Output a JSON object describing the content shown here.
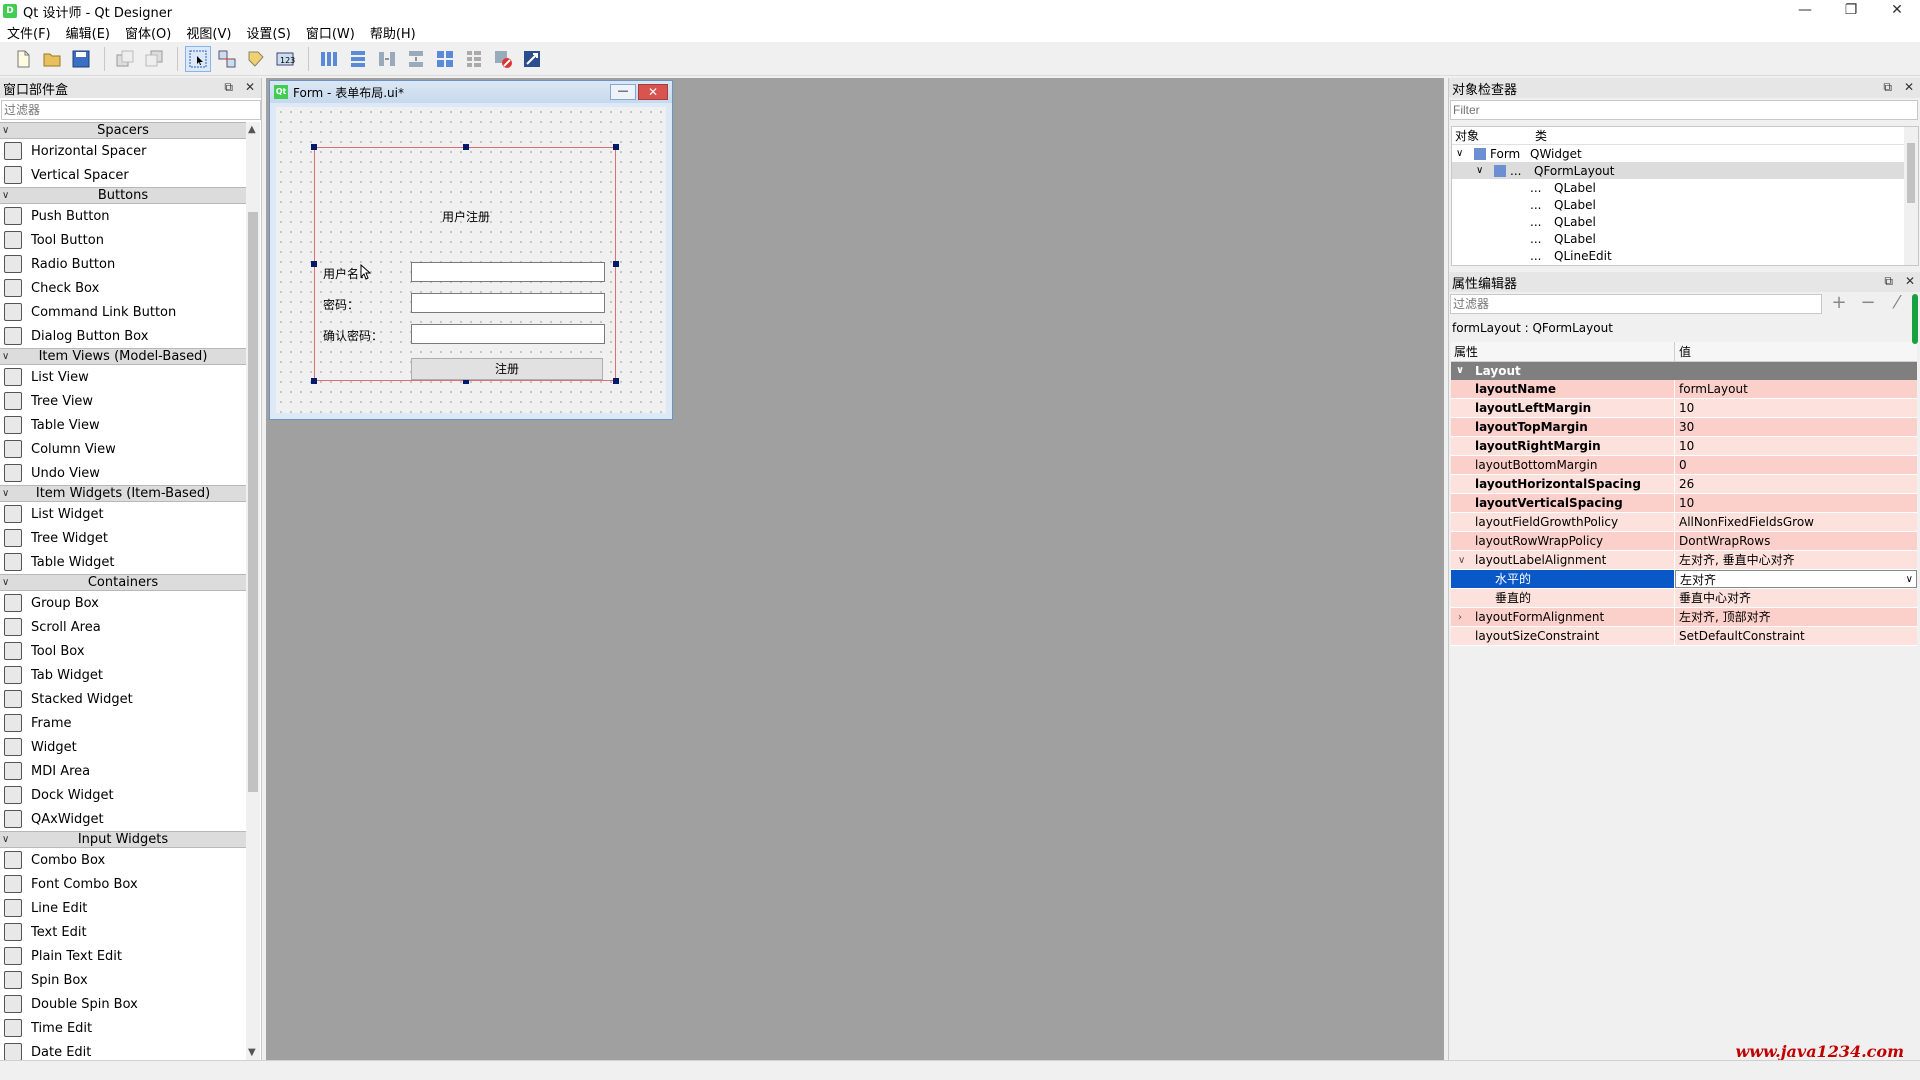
{
  "window": {
    "title": "Qt 设计师 - Qt Designer",
    "icon_text": "D",
    "minimize": "—",
    "restore": "❐",
    "close": "✕"
  },
  "menu": [
    "文件(F)",
    "编辑(E)",
    "窗体(O)",
    "视图(V)",
    "设置(S)",
    "窗口(W)",
    "帮助(H)"
  ],
  "widget_box": {
    "title": "窗口部件盒",
    "filter_placeholder": "过滤器",
    "categories": [
      {
        "name": "Spacers",
        "items": [
          "Horizontal Spacer",
          "Vertical Spacer"
        ]
      },
      {
        "name": "Buttons",
        "items": [
          "Push Button",
          "Tool Button",
          "Radio Button",
          "Check Box",
          "Command Link Button",
          "Dialog Button Box"
        ]
      },
      {
        "name": "Item Views (Model-Based)",
        "items": [
          "List View",
          "Tree View",
          "Table View",
          "Column View",
          "Undo View"
        ]
      },
      {
        "name": "Item Widgets (Item-Based)",
        "items": [
          "List Widget",
          "Tree Widget",
          "Table Widget"
        ]
      },
      {
        "name": "Containers",
        "items": [
          "Group Box",
          "Scroll Area",
          "Tool Box",
          "Tab Widget",
          "Stacked Widget",
          "Frame",
          "Widget",
          "MDI Area",
          "Dock Widget",
          "QAxWidget"
        ]
      },
      {
        "name": "Input Widgets",
        "items": [
          "Combo Box",
          "Font Combo Box",
          "Line Edit",
          "Text Edit",
          "Plain Text Edit",
          "Spin Box",
          "Double Spin Box",
          "Time Edit",
          "Date Edit"
        ]
      }
    ]
  },
  "form": {
    "window_title": "Form - 表单布局.ui*",
    "icon_text": "Qt",
    "min_glyph": "—",
    "close_glyph": "✕",
    "heading": "用户注册",
    "fields": [
      {
        "label": "用户名：",
        "value": ""
      },
      {
        "label": "密码：",
        "value": ""
      },
      {
        "label": "确认密码：",
        "value": ""
      }
    ],
    "button": "注册"
  },
  "object_inspector": {
    "title": "对象检查器",
    "filter_placeholder": "Filter",
    "columns": [
      "对象",
      "类"
    ],
    "rows": [
      {
        "object": "Form",
        "class": "QWidget",
        "indent": 0,
        "expanded": true
      },
      {
        "object": "...",
        "class": "QFormLayout",
        "indent": 1,
        "expanded": true,
        "selected": true
      },
      {
        "object": "...",
        "class": "QLabel",
        "indent": 2
      },
      {
        "object": "...",
        "class": "QLabel",
        "indent": 2
      },
      {
        "object": "...",
        "class": "QLabel",
        "indent": 2
      },
      {
        "object": "...",
        "class": "QLabel",
        "indent": 2
      },
      {
        "object": "...",
        "class": "QLineEdit",
        "indent": 2
      }
    ]
  },
  "property_editor": {
    "title": "属性编辑器",
    "filter_placeholder": "过滤器",
    "object_name": "formLayout : QFormLayout",
    "columns": [
      "属性",
      "值"
    ],
    "group": "Layout",
    "rows": [
      {
        "name": "layoutName",
        "value": "formLayout",
        "bold": true
      },
      {
        "name": "layoutLeftMargin",
        "value": "10",
        "bold": true
      },
      {
        "name": "layoutTopMargin",
        "value": "30",
        "bold": true
      },
      {
        "name": "layoutRightMargin",
        "value": "10",
        "bold": true
      },
      {
        "name": "layoutBottomMargin",
        "value": "0",
        "bold": false
      },
      {
        "name": "layoutHorizontalSpacing",
        "value": "26",
        "bold": true
      },
      {
        "name": "layoutVerticalSpacing",
        "value": "10",
        "bold": true
      },
      {
        "name": "layoutFieldGrowthPolicy",
        "value": "AllNonFixedFieldsGrow",
        "bold": false
      },
      {
        "name": "layoutRowWrapPolicy",
        "value": "DontWrapRows",
        "bold": false
      },
      {
        "name": "layoutLabelAlignment",
        "value": "左对齐, 垂直中心对齐",
        "bold": false,
        "expander": "open"
      },
      {
        "name": "水平的",
        "value": "左对齐",
        "bold": false,
        "sub": true,
        "selected": true
      },
      {
        "name": "垂直的",
        "value": "垂直中心对齐",
        "bold": false,
        "sub": true
      },
      {
        "name": "layoutFormAlignment",
        "value": "左对齐, 顶部对齐",
        "bold": false,
        "expander": "closed"
      },
      {
        "name": "layoutSizeConstraint",
        "value": "SetDefaultConstraint",
        "bold": false
      }
    ]
  },
  "watermark": "www.java1234.com",
  "colors": {
    "selection": "#0a58c8",
    "changed_row": "#fbd0cb",
    "group_header": "#7f7f7f",
    "mdi_bg": "#a0a0a0"
  }
}
